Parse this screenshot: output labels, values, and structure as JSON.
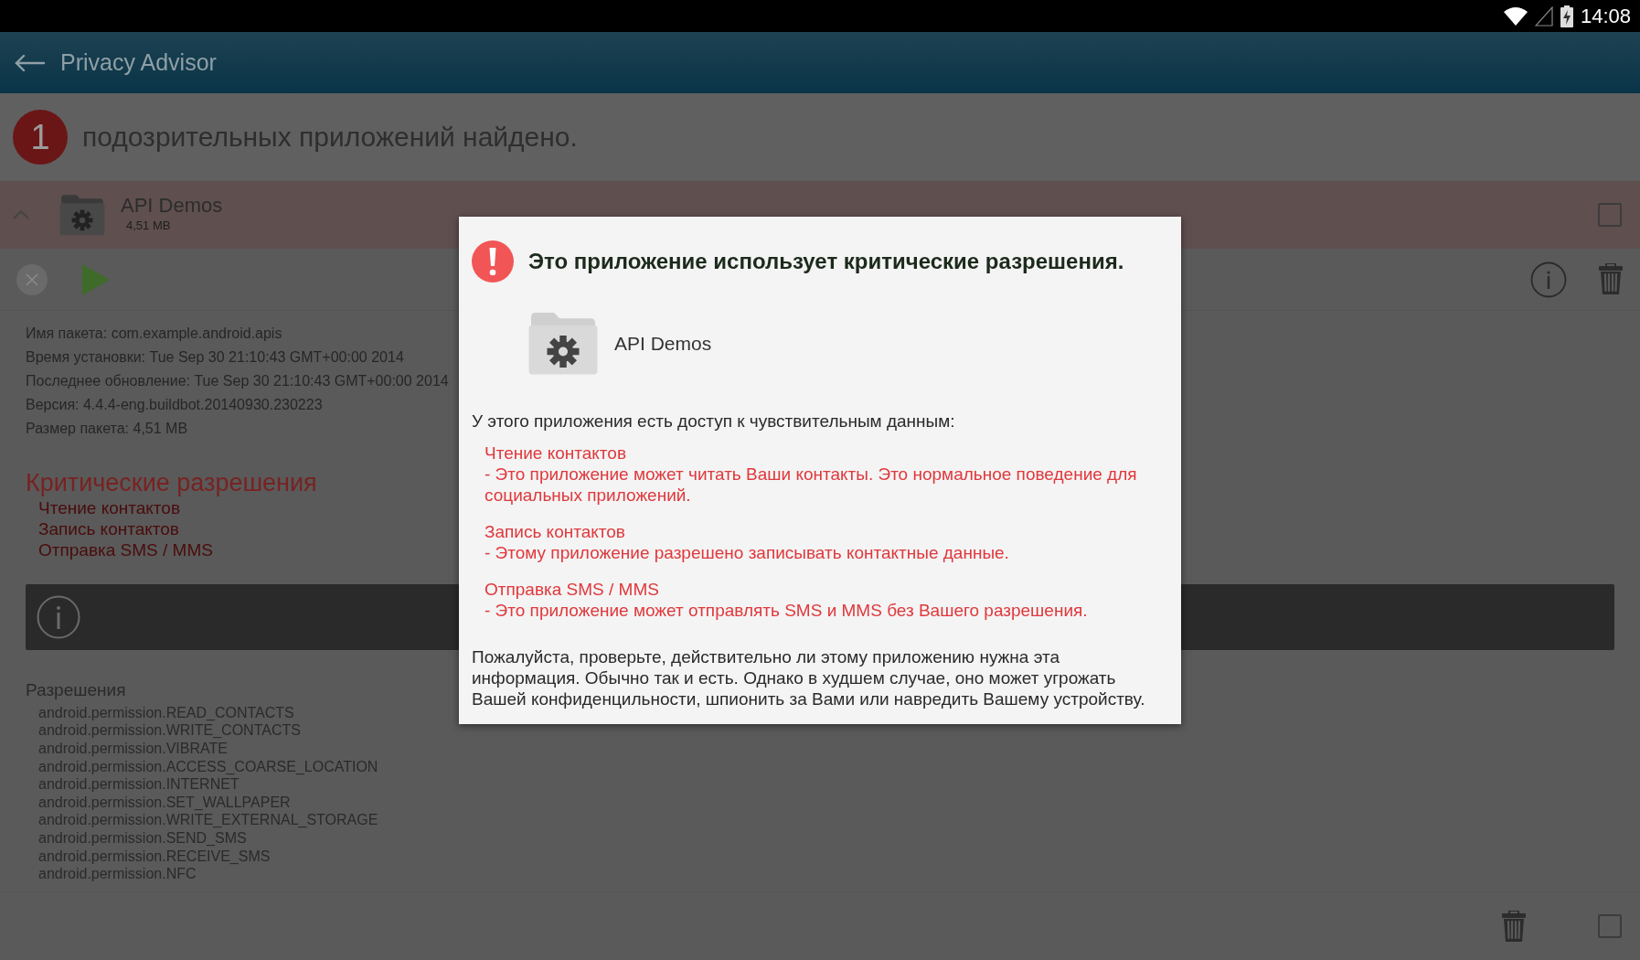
{
  "status_bar": {
    "time": "14:08"
  },
  "app_bar": {
    "title": "Privacy Advisor"
  },
  "summary": {
    "count": "1",
    "text": "подозрительных приложений найдено."
  },
  "app": {
    "name": "API Demos",
    "size": "4,51 MB",
    "expanded": true,
    "checked": false
  },
  "details": [
    "Имя пакета: com.example.android.apis",
    "Время установки: Tue Sep 30 21:10:43 GMT+00:00 2014",
    "Последнее обновление: Tue Sep 30 21:10:43 GMT+00:00 2014",
    "Версия: 4.4.4-eng.buildbot.20140930.230223",
    "Размер пакета: 4,51 MB"
  ],
  "critical_permissions": {
    "title": "Критические разрешения",
    "items": [
      "Чтение контактов",
      "Запись контактов",
      "Отправка SMS / MMS"
    ]
  },
  "permissions": {
    "title": "Разрешения",
    "items": [
      "android.permission.READ_CONTACTS",
      "android.permission.WRITE_CONTACTS",
      "android.permission.VIBRATE",
      "android.permission.ACCESS_COARSE_LOCATION",
      "android.permission.INTERNET",
      "android.permission.SET_WALLPAPER",
      "android.permission.WRITE_EXTERNAL_STORAGE",
      "android.permission.SEND_SMS",
      "android.permission.RECEIVE_SMS",
      "android.permission.NFC"
    ]
  },
  "bottom_bar": {
    "checked": false
  },
  "dialog": {
    "title": "Это приложение использует критические разрешения.",
    "app_name": "API Demos",
    "intro": "У этого приложения есть доступ к чувствительным данным:",
    "items": [
      {
        "name": "Чтение контактов",
        "description": "- Это приложение может читать Ваши контакты. Это нормальное поведение для социальных приложений."
      },
      {
        "name": "Запись контактов",
        "description": "- Этому приложение разрешено записывать контактные данные."
      },
      {
        "name": "Отправка SMS / MMS",
        "description": "- Это приложение может отправлять SMS и MMS без Вашего разрешения."
      }
    ],
    "footer": "Пожалуйста, проверьте, действительно ли этому приложению нужна эта информация. Обычно так и есть. Однако в худшем случае, оно может угрожать Вашей конфиденцильности, шпионить за Вами или навредить Вашему устройству."
  }
}
